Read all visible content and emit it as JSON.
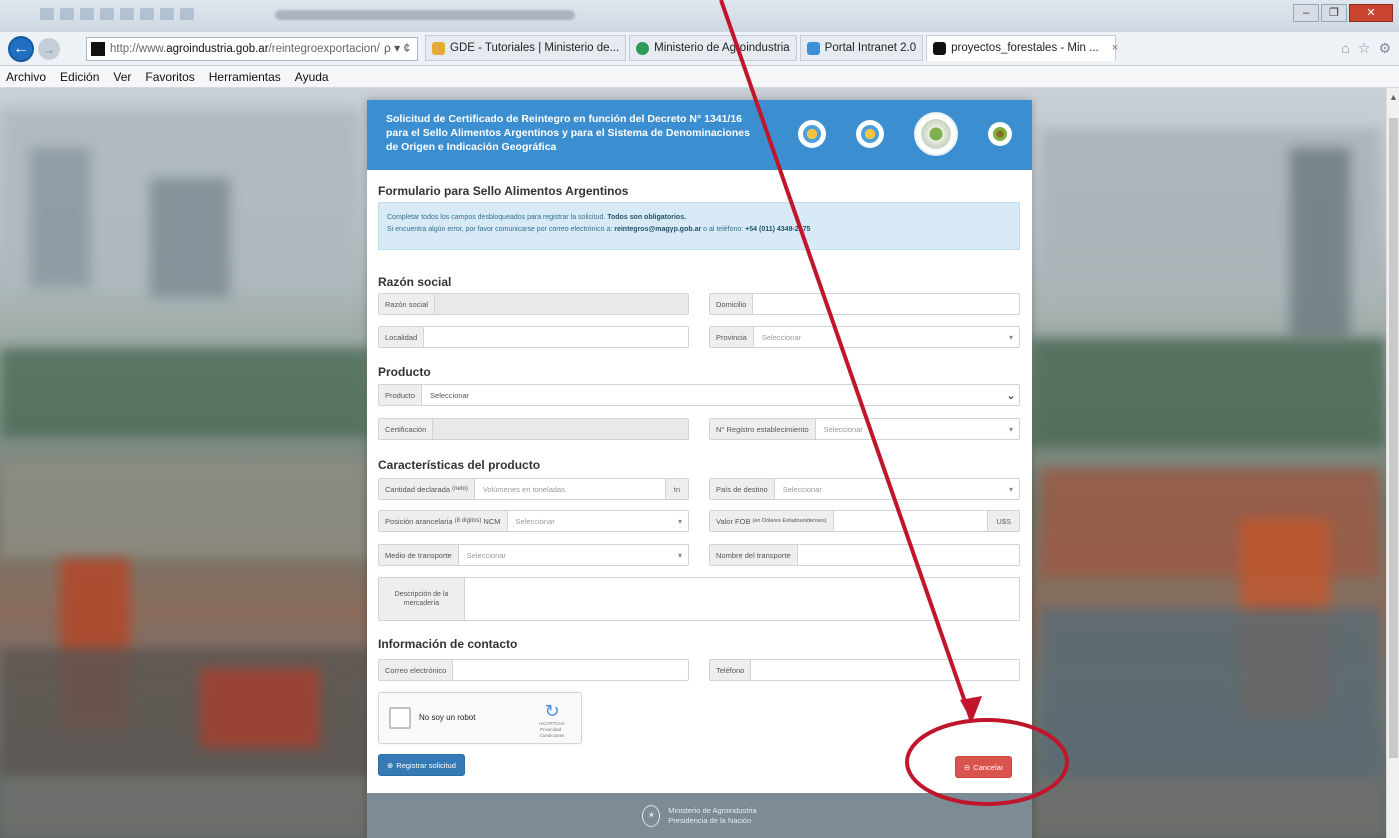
{
  "browser": {
    "url_prefix": "http://www.",
    "url_domain": "agroindustria.gob.ar",
    "url_path": "/reintegroexportacion/",
    "url_controls": "ρ ▾ ¢",
    "tabs": [
      {
        "label": "GDE - Tutoriales | Ministerio de...",
        "color": "#e5a93a"
      },
      {
        "label": "Ministerio de Agroindustria",
        "color": "#2e9a5a"
      },
      {
        "label": "Portal Intranet 2.0",
        "color": "#3c8fd6"
      },
      {
        "label": "proyectos_forestales - Min ...",
        "color": "#111111",
        "close": "×"
      }
    ],
    "menu": [
      "Archivo",
      "Edición",
      "Ver",
      "Favoritos",
      "Herramientas",
      "Ayuda"
    ],
    "window_controls": {
      "minimize": "–",
      "restore": "❐",
      "close": "✕"
    },
    "right_icons": [
      "⌂",
      "☆",
      "⚙"
    ],
    "scroll_arrow": "▲"
  },
  "form": {
    "header_title": "Solicitud de Certificado de Reintegro en función del Decreto N° 1341/16 para el Sello Alimentos Argentinos y para el Sistema de Denominaciones de Origen e Indicación Geográfica",
    "subtitle": "Formulario para Sello Alimentos Argentinos",
    "info_line1_a": "Completar todos los campos desbloqueados para registrar la solicitud. ",
    "info_line1_b": "Todos son obligatorios.",
    "info_line2_a": "Si encuentra algún error, por favor comunicarse por correo electrónico a: ",
    "info_line2_email": "reintegros@magyp.gob.ar",
    "info_line2_b": " o al teléfono: ",
    "info_line2_phone": "+54 (011) 4349-2175",
    "sections": {
      "razon": "Razón social",
      "producto": "Producto",
      "caracteristicas": "Características del producto",
      "contacto": "Información de contacto"
    },
    "labels": {
      "razon_social": "Razón social",
      "domicilio": "Domicilio",
      "localidad": "Localidad",
      "provincia": "Provincia",
      "producto": "Producto",
      "certificacion": "Certificación",
      "registro": "N° Registro establecimiento",
      "cantidad": "Cantidad declarada",
      "cantidad_sub": "(neto)",
      "pais": "País de destino",
      "posicion": "Posición arancelaria",
      "posicion_sub": "(8 dígitos)",
      "posicion_ncm": "NCM",
      "valor_fob": "Valor FOB",
      "valor_fob_sub": "(en Dólares Estadounidenses)",
      "medio": "Medio de transporte",
      "nombre_transporte": "Nombre del transporte",
      "descripcion": "Descripción de la mercadería",
      "correo": "Correo electrónico",
      "telefono": "Teléfono"
    },
    "placeholders": {
      "seleccionar": "Seleccionar",
      "volumenes": "Volúmenes en toneladas"
    },
    "units": {
      "tn": "tn",
      "usd": "U$S"
    },
    "carets": {
      "small": "▾",
      "big": "⌄"
    },
    "captcha": {
      "label": "No soy un robot",
      "brand": "reCAPTCHA",
      "terms": "Privacidad - Condiciones",
      "logo": "↻"
    },
    "buttons": {
      "register": "Registrar solicitud",
      "register_icon": "⊕",
      "cancel": "Cancelar",
      "cancel_icon": "⊖"
    },
    "footer": {
      "line1": "Ministerio de Agroindustria",
      "line2": "Presidencia de la Nación",
      "emblem": "☀"
    }
  },
  "colors": {
    "header": "#3b8ed0",
    "primary_button": "#337ab7",
    "danger_button": "#d9534f",
    "annotation": "#c0152a"
  }
}
